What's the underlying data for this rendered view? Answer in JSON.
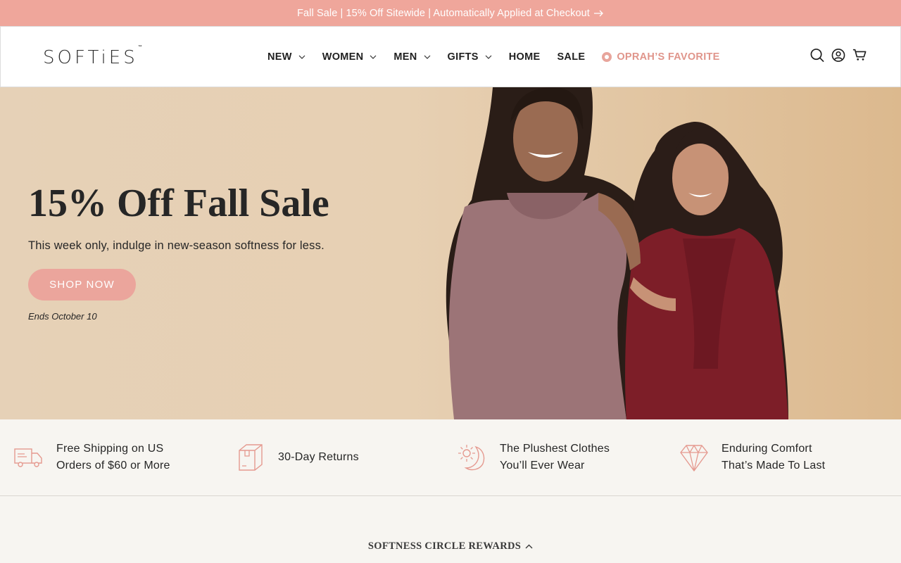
{
  "announcement": {
    "text": "Fall Sale | 15% Off Sitewide | Automatically Applied at Checkout"
  },
  "header": {
    "logo": "SOFTiES",
    "logo_mark": "™",
    "nav": [
      {
        "label": "NEW",
        "has_dropdown": true
      },
      {
        "label": "WOMEN",
        "has_dropdown": true
      },
      {
        "label": "MEN",
        "has_dropdown": true
      },
      {
        "label": "GIFTS",
        "has_dropdown": true
      },
      {
        "label": "HOME",
        "has_dropdown": false
      },
      {
        "label": "SALE",
        "has_dropdown": false
      },
      {
        "label": "OPRAH’S FAVORITE",
        "has_dropdown": false
      }
    ],
    "icons": [
      "search-icon",
      "account-icon",
      "cart-icon"
    ]
  },
  "hero": {
    "title": "15% Off Fall Sale",
    "subtitle": "This week only, indulge in new-season softness for less.",
    "cta": "SHOP NOW",
    "ends": "Ends October 10"
  },
  "features": [
    {
      "icon": "truck-icon",
      "line1": "Free Shipping on US",
      "line2": "Orders of $60 or More"
    },
    {
      "icon": "box-icon",
      "line1": "30-Day Returns",
      "line2": ""
    },
    {
      "icon": "sun-moon-icon",
      "line1": "The Plushest Clothes",
      "line2": "You’ll Ever Wear"
    },
    {
      "icon": "diamond-icon",
      "line1": "Enduring Comfort",
      "line2": "That’s Made To Last"
    }
  ],
  "rewards": {
    "label": "SOFTNESS CIRCLE REWARDS"
  },
  "colors": {
    "accent": "#efa69b",
    "button": "#eba59c",
    "oprah": "#e0958b",
    "icon_stroke": "#e59a90"
  }
}
